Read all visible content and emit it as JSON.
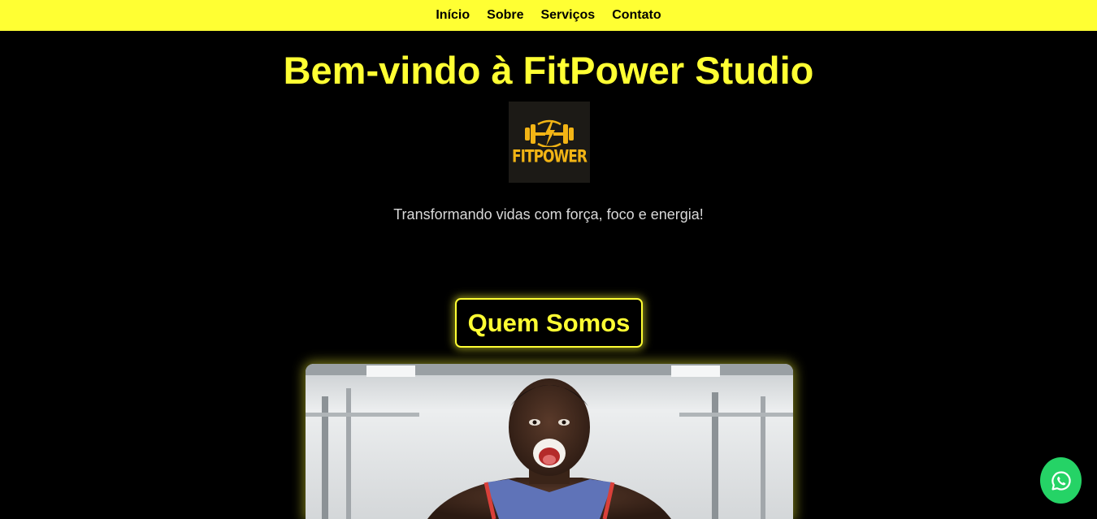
{
  "nav": {
    "items": [
      {
        "label": "Início"
      },
      {
        "label": "Sobre"
      },
      {
        "label": "Serviços"
      },
      {
        "label": "Contato"
      }
    ]
  },
  "hero": {
    "title": "Bem-vindo à FitPower Studio",
    "logo_text": "FITPOWER",
    "tagline": "Transformando vidas com força, foco e energia!"
  },
  "about": {
    "title": "Quem Somos",
    "photo_alt": "Atleta gritando na academia"
  },
  "whatsapp": {
    "icon": "whatsapp-icon"
  },
  "colors": {
    "accent": "#ffff33",
    "background": "#000000",
    "logo_gold": "#f2b415",
    "whatsapp_green": "#25d366"
  }
}
